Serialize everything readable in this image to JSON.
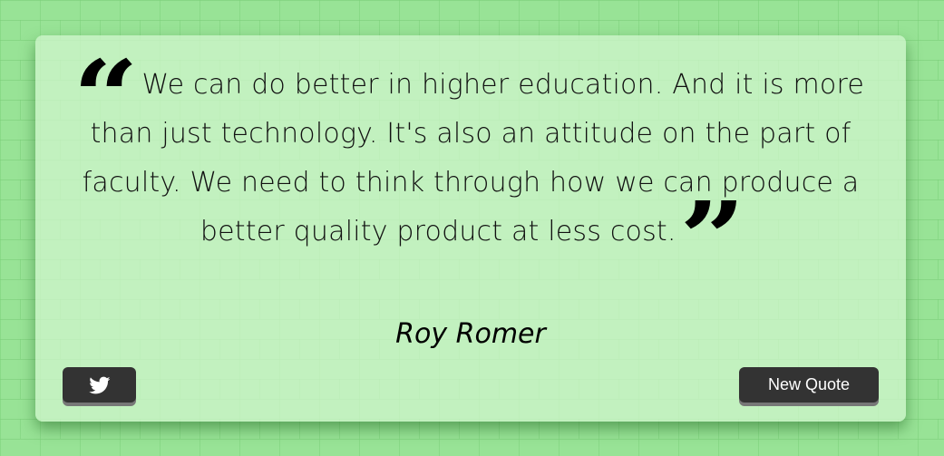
{
  "quote": {
    "open_mark": "“",
    "text": "We can do better in higher education. And it is more than just technology. It's also an attitude on the part of faculty. We need to think through how we can produce a better quality product at less cost.",
    "close_mark": "”",
    "author": "Roy Romer"
  },
  "actions": {
    "tweet_icon": "twitter-icon",
    "new_quote_label": "New Quote"
  },
  "colors": {
    "background": "#98e396",
    "card": "#c3f0bd",
    "button": "#333333",
    "button_text": "#ffffff"
  }
}
